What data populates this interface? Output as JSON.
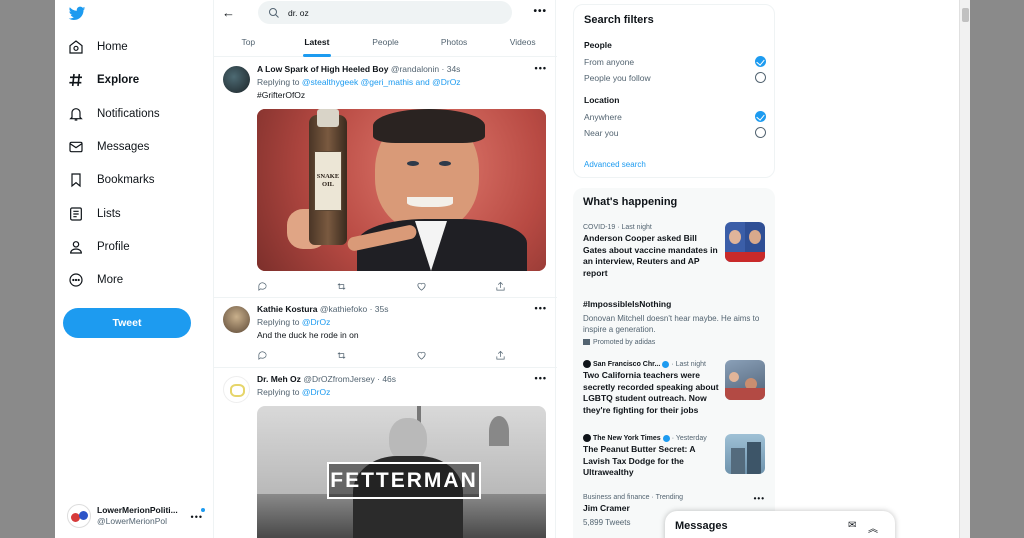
{
  "sidebar": {
    "items": [
      {
        "label": "Home",
        "icon": "home-icon"
      },
      {
        "label": "Explore",
        "icon": "hashtag-icon",
        "active": true
      },
      {
        "label": "Notifications",
        "icon": "bell-icon"
      },
      {
        "label": "Messages",
        "icon": "envelope-icon"
      },
      {
        "label": "Bookmarks",
        "icon": "bookmark-icon"
      },
      {
        "label": "Lists",
        "icon": "list-icon"
      },
      {
        "label": "Profile",
        "icon": "person-icon"
      },
      {
        "label": "More",
        "icon": "more-circle-icon"
      }
    ],
    "tweet_button": "Tweet",
    "account": {
      "name": "LowerMerionPoliti...",
      "handle": "@LowerMerionPol"
    }
  },
  "search": {
    "query": "dr. oz"
  },
  "tabs": [
    {
      "label": "Top"
    },
    {
      "label": "Latest",
      "active": true
    },
    {
      "label": "People"
    },
    {
      "label": "Photos"
    },
    {
      "label": "Videos"
    }
  ],
  "tweets": [
    {
      "name": "A Low Spark of High Heeled Boy",
      "handle": "@randalonin",
      "time": "· 34s",
      "replying_prefix": "Replying to",
      "replying_to": "@stealthygeek @geri_mathis and @DrOz",
      "body": "#GrifterOfOz",
      "image_text": [
        "SNAKE",
        "OIL"
      ]
    },
    {
      "name": "Kathie Kostura",
      "handle": "@kathiefoko",
      "time": "· 35s",
      "replying_prefix": "Replying to",
      "replying_to": "@DrOz",
      "body": "And the duck he rode in on"
    },
    {
      "name": "Dr. Meh Oz",
      "handle": "@DrOZfromJersey",
      "time": "· 46s",
      "replying_prefix": "Replying to",
      "replying_to": "@DrOz",
      "image_text": "FETTERMAN"
    }
  ],
  "filters": {
    "title": "Search filters",
    "people_title": "People",
    "people_options": [
      "From anyone",
      "People you follow"
    ],
    "location_title": "Location",
    "location_options": [
      "Anywhere",
      "Near you"
    ],
    "advanced": "Advanced search"
  },
  "happening": {
    "title": "What's happening",
    "trends": [
      {
        "meta": "COVID-19 · Last night",
        "headline": "Anderson Cooper asked Bill Gates about vaccine mandates in an interview, Reuters and AP report"
      },
      {
        "headline": "#ImpossibleIsNothing",
        "desc": "Donovan Mitchell doesn't hear maybe. He aims to inspire a generation.",
        "promo": "Promoted by adidas"
      },
      {
        "source": "San Francisco Chr...",
        "meta": "· Last night",
        "headline": "Two California teachers were secretly recorded speaking about LGBTQ student outreach. Now they're fighting for their jobs"
      },
      {
        "source": "The New York Times",
        "meta": "· Yesterday",
        "headline": "The Peanut Butter Secret: A Lavish Tax Dodge for the Ultrawealthy"
      },
      {
        "meta": "Business and finance · Trending",
        "headline": "Jim Cramer",
        "desc": "5,899 Tweets"
      }
    ]
  },
  "messages_drawer": {
    "title": "Messages"
  }
}
